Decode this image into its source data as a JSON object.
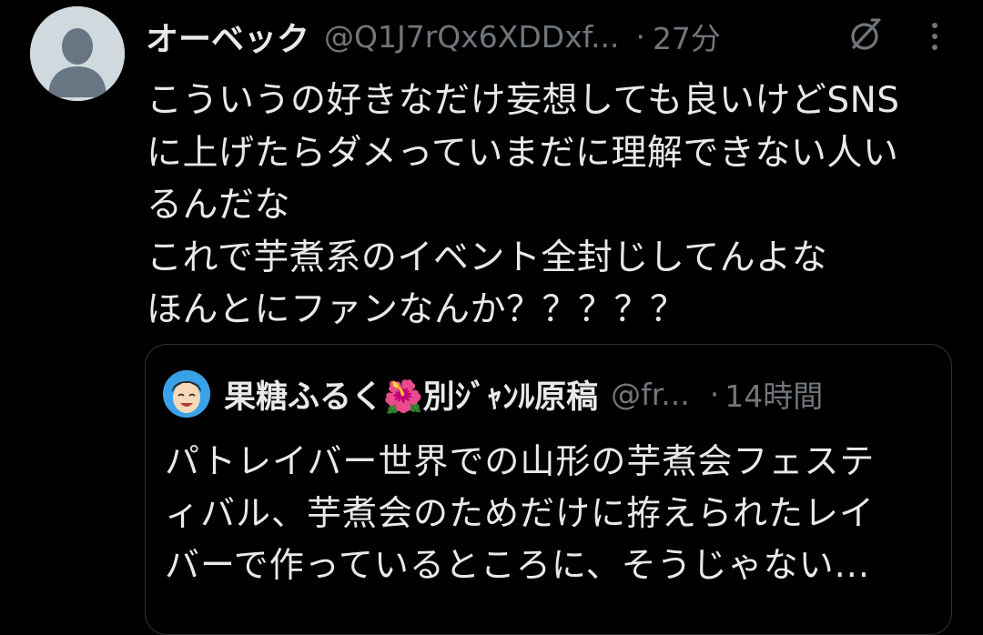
{
  "tweet": {
    "display_name": "オーベック",
    "handle": "@Q1J7rQx6XDDxf...",
    "separator": "·",
    "time": "27分",
    "text": "こういうの好きなだけ妄想しても良いけどSNS\nに上げたらダメっていまだに理解できない人い\nるんだな\nこれで芋煮系のイベント全封じしてんよな\nほんとにファンなんか？？？？？",
    "icons": {
      "avatar": "default-avatar-icon",
      "grok": "grok-icon",
      "more": "more-vertical-icon"
    }
  },
  "quoted_tweet": {
    "display_name": "果糖ふるく🌺別ｼﾞｬﾝﾙ原稿",
    "handle": "@fr...",
    "separator": "·",
    "time": "14時間",
    "text": "パトレイバー世界での山形の芋煮会フェステ\nィバル、芋煮会のためだけに拵えられたレイ\nバーで作っているところに、そうじゃない..."
  },
  "colors": {
    "background": "#000000",
    "primary_text": "#e7e9ea",
    "secondary_text": "#71767b",
    "border": "#2f3336",
    "avatar_bg": "#cfd9de",
    "avatar_fg": "#687684"
  }
}
